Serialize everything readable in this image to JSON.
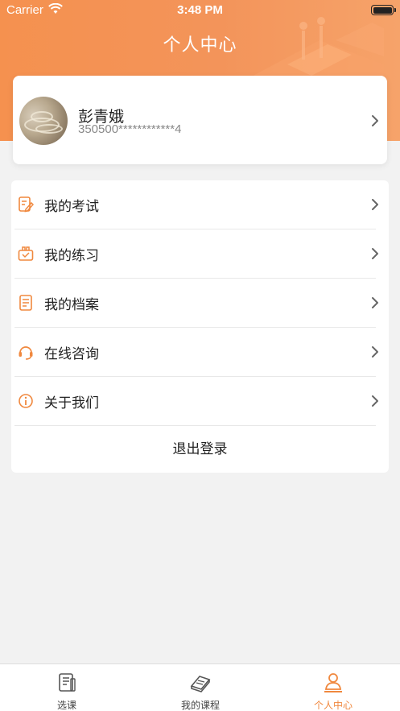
{
  "status_bar": {
    "carrier": "Carrier",
    "time": "3:48 PM"
  },
  "header": {
    "title": "个人中心"
  },
  "profile": {
    "name": "彭青娥",
    "id_number": "350500************4"
  },
  "menu": {
    "items": [
      {
        "label": "我的考试",
        "icon": "exam-icon"
      },
      {
        "label": "我的练习",
        "icon": "practice-icon"
      },
      {
        "label": "我的档案",
        "icon": "archive-icon"
      },
      {
        "label": "在线咨询",
        "icon": "headset-icon"
      },
      {
        "label": "关于我们",
        "icon": "info-icon"
      }
    ],
    "logout_label": "退出登录"
  },
  "tabbar": {
    "tabs": [
      {
        "label": "选课",
        "icon": "course-select-icon",
        "active": false
      },
      {
        "label": "我的课程",
        "icon": "book-icon",
        "active": false
      },
      {
        "label": "个人中心",
        "icon": "person-icon",
        "active": true
      }
    ]
  },
  "colors": {
    "accent": "#f0883e",
    "header": "#f5914f",
    "background": "#f2f2f2"
  }
}
